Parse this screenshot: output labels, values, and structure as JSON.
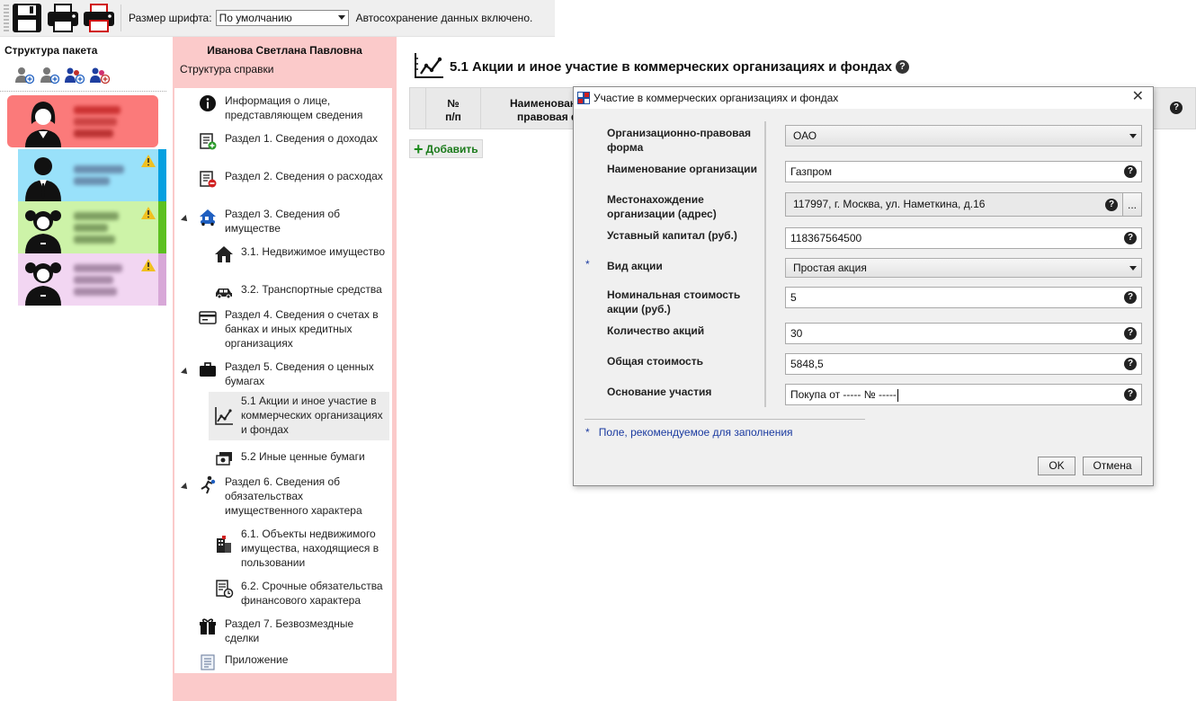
{
  "toolbar": {
    "font_size_label": "Размер шрифта:",
    "font_size_value": "По умолчанию",
    "autosave_text": "Автосохранение данных включено.",
    "icons": [
      "save-icon",
      "print-icon",
      "print-red-icon"
    ]
  },
  "structure": {
    "title": "Структура пакета",
    "person_icons": [
      "add-person-icon",
      "add-spouse-icon",
      "add-child-icon",
      "add-child-female-icon"
    ],
    "cards": [
      {
        "color": "#fb7a7a",
        "avatar": "woman-avatar",
        "warning": false
      },
      {
        "color": "#99e1fa",
        "avatar": "man-avatar",
        "warning": true
      },
      {
        "color": "#cdf3a8",
        "avatar": "girl-avatar",
        "warning": true
      },
      {
        "color": "#f2d6f2",
        "avatar": "girl-avatar",
        "warning": true
      }
    ]
  },
  "reference": {
    "person_name": "Иванова Светлана Павловна",
    "structure_label": "Структура справки",
    "items": [
      {
        "label": "Информация о лице, представляющем сведения",
        "icon": "info-icon"
      },
      {
        "label": "Раздел 1. Сведения о доходах",
        "icon": "income-icon"
      },
      {
        "label": "Раздел 2. Сведения о расходах",
        "icon": "expense-icon"
      },
      {
        "label": "Раздел 3. Сведения об имуществе",
        "icon": "property-icon"
      },
      {
        "label": "3.1. Недвижимое имущество",
        "icon": "house-icon"
      },
      {
        "label": "3.2. Транспортные средства",
        "icon": "car-icon"
      },
      {
        "label": "Раздел 4. Сведения о счетах в банках и иных кредитных организациях",
        "icon": "bank-card-icon"
      },
      {
        "label": "Раздел 5. Сведения о ценных бумагах",
        "icon": "briefcase-icon"
      },
      {
        "label": "5.1 Акции и иное участие в коммерческих организациях и фондах",
        "icon": "stocks-chart-icon"
      },
      {
        "label": "5.2 Иные ценные бумаги",
        "icon": "securities-icon"
      },
      {
        "label": "Раздел 6. Сведения об обязательствах имущественного характера",
        "icon": "obligations-icon"
      },
      {
        "label": "6.1. Объекты недвижимого имущества, находящиеся в пользовании",
        "icon": "building-icon"
      },
      {
        "label": "6.2. Срочные обязательства финансового характера",
        "icon": "document-clock-icon"
      },
      {
        "label": "Раздел 7. Безвозмездные сделки",
        "icon": "gift-icon"
      },
      {
        "label": "Приложение",
        "icon": "attachment-icon"
      }
    ]
  },
  "main": {
    "title": "5.1 Акции и иное участие в коммерческих организациях и фондах",
    "col_num": "№\nп/п",
    "col_name": "Наименование и организационно-\nправовая форма",
    "col_name_visible": "Наименован",
    "col_name_visible2": "правовая ф",
    "add_label": "Добавить"
  },
  "dialog": {
    "title": "Участие в коммерческих организациях и фондах",
    "fields": [
      {
        "label": "Организационно-правовая форма",
        "value": "ОАО",
        "type": "dropdown",
        "required": false
      },
      {
        "label": "Наименование организации",
        "value": "Газпром",
        "type": "text",
        "required": false
      },
      {
        "label": "Местонахождение организации (адрес)",
        "value": "117997, г. Москва, ул. Наметкина, д.16",
        "type": "readonly",
        "required": false
      },
      {
        "label": "Уставный капитал (руб.)",
        "value": "118367564500",
        "type": "text",
        "required": false
      },
      {
        "label": "Вид акции",
        "value": "Простая акция",
        "type": "dropdown",
        "required": true
      },
      {
        "label": "Номинальная стоимость акции (руб.)",
        "value": "5",
        "type": "text",
        "required": false
      },
      {
        "label": "Количество акций",
        "value": "30",
        "type": "text",
        "required": false
      },
      {
        "label": "Общая стоимость",
        "value": "5848,5",
        "type": "text",
        "required": false
      },
      {
        "label": "Основание участия",
        "value": "Покупа от ----- № -----",
        "type": "text",
        "required": false
      }
    ],
    "browse_label": "...",
    "note_star": "*",
    "note": "Поле, рекомендуемое для заполнения",
    "ok_label": "OK",
    "cancel_label": "Отмена",
    "help_glyph": "?",
    "close_glyph": "✕"
  },
  "colors": {
    "accent_pink": "#fbcaca",
    "add_green": "#1a7a1a",
    "note_blue": "#1a3aa0"
  }
}
